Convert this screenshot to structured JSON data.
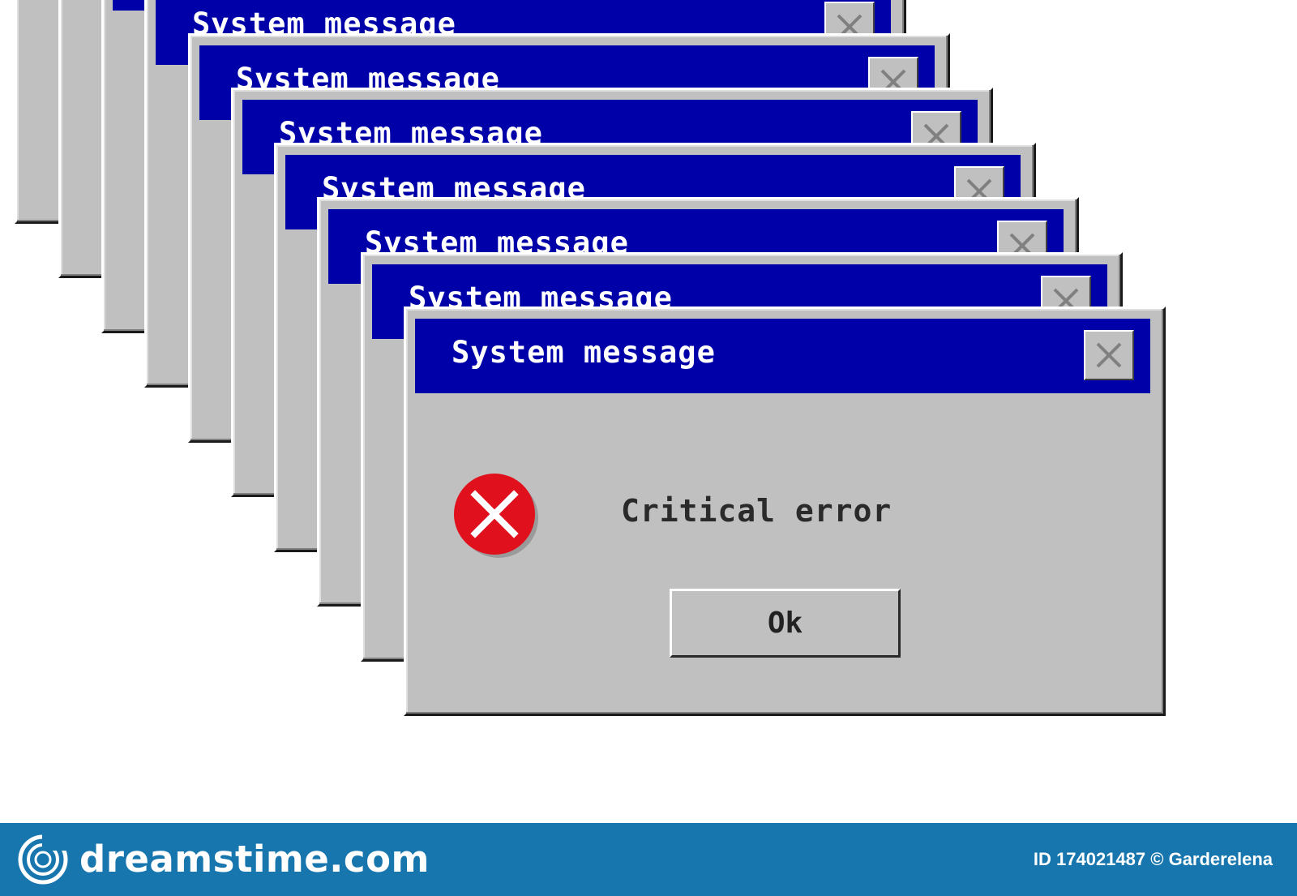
{
  "dialog_stack": {
    "title": "System message",
    "background_windows": 9
  },
  "front_dialog": {
    "title": "System message",
    "message": "Critical error",
    "ok_label": "Ok",
    "icon": "error-x-circle-icon",
    "close_icon": "close-icon"
  },
  "footer": {
    "site": "dreamstime.com",
    "id_label": "ID 174021487 © Garderelena",
    "logo_icon": "spiral-logo-icon"
  },
  "colors": {
    "titlebar": "#0000a8",
    "window": "#c0c0c0",
    "error": "#e0101c",
    "footer": "#1776ae"
  }
}
